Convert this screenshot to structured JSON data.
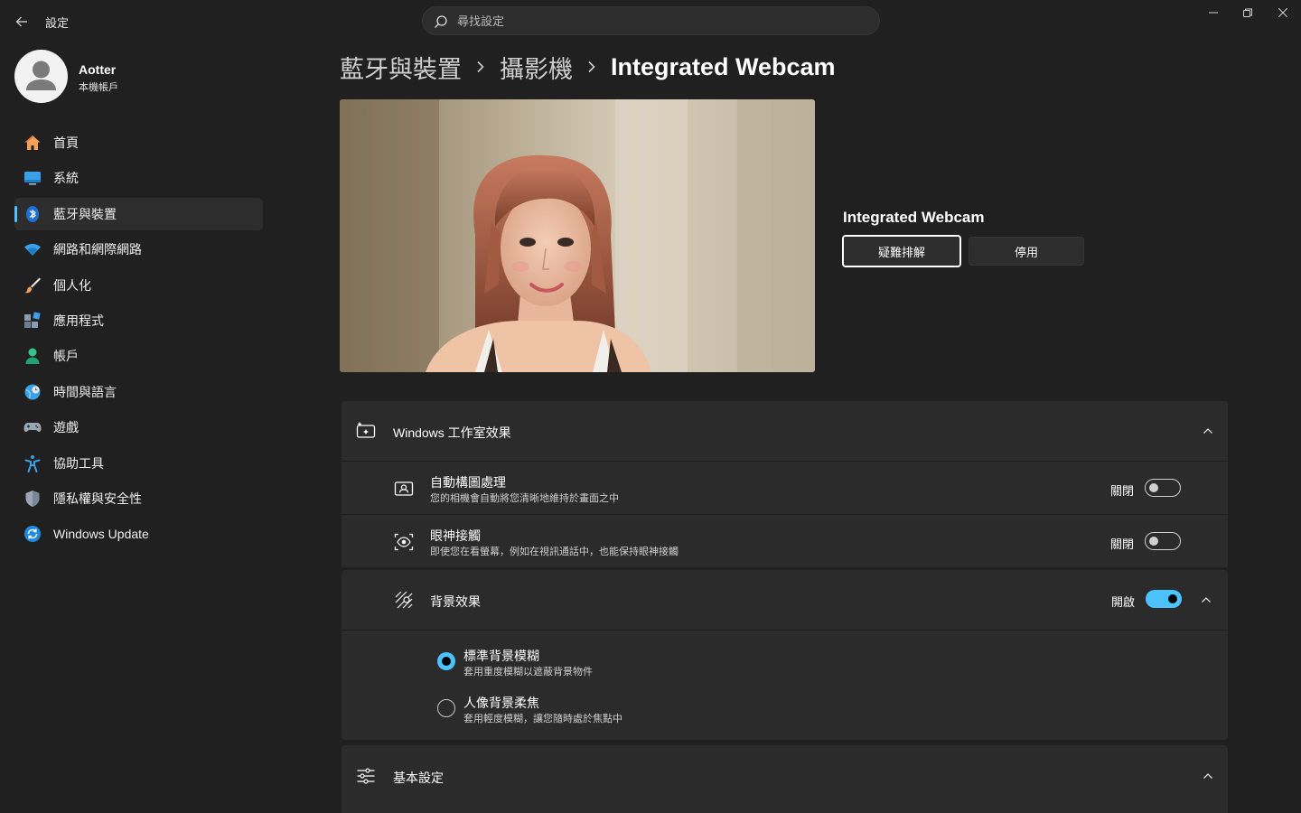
{
  "window": {
    "app_title": "設定",
    "search_placeholder": "尋找設定"
  },
  "profile": {
    "name": "Aotter",
    "account_type": "本機帳戶"
  },
  "sidebar": {
    "items": [
      {
        "label": "首頁",
        "icon": "home-icon",
        "selected": false
      },
      {
        "label": "系統",
        "icon": "system-display-icon",
        "selected": false
      },
      {
        "label": "藍牙與裝置",
        "icon": "bluetooth-icon",
        "selected": true
      },
      {
        "label": "網路和網際網路",
        "icon": "wifi-icon",
        "selected": false
      },
      {
        "label": "個人化",
        "icon": "brush-icon",
        "selected": false
      },
      {
        "label": "應用程式",
        "icon": "apps-icon",
        "selected": false
      },
      {
        "label": "帳戶",
        "icon": "person-icon",
        "selected": false
      },
      {
        "label": "時間與語言",
        "icon": "globe-clock-icon",
        "selected": false
      },
      {
        "label": "遊戲",
        "icon": "gamepad-icon",
        "selected": false
      },
      {
        "label": "協助工具",
        "icon": "accessibility-icon",
        "selected": false
      },
      {
        "label": "隱私權與安全性",
        "icon": "shield-icon",
        "selected": false
      },
      {
        "label": "Windows Update",
        "icon": "update-icon",
        "selected": false
      }
    ]
  },
  "breadcrumb": [
    "藍牙與裝置",
    "攝影機",
    "Integrated Webcam"
  ],
  "camera": {
    "name": "Integrated Webcam",
    "troubleshoot_label": "疑難排解",
    "disable_label": "停用"
  },
  "studio_effects": {
    "title": "Windows 工作室效果",
    "auto_framing": {
      "title": "自動構圖處理",
      "subtitle": "您的相機會自動將您清晰地維持於畫面之中",
      "state_label": "關閉"
    },
    "eye_contact": {
      "title": "眼神接觸",
      "subtitle": "即使您在看螢幕，例如在視訊通話中，也能保持眼神接觸",
      "state_label": "關閉"
    },
    "background_effects": {
      "title": "背景效果",
      "state_label": "開啟",
      "options": [
        {
          "title": "標準背景模糊",
          "subtitle": "套用重度模糊以遮蔽背景物件",
          "checked": true
        },
        {
          "title": "人像背景柔焦",
          "subtitle": "套用輕度模糊，讓您隨時處於焦點中",
          "checked": false
        }
      ]
    }
  },
  "basic_settings": {
    "title": "基本設定"
  },
  "colors": {
    "accent": "#4cc2ff",
    "background": "#202020",
    "card": "#2b2b2b"
  }
}
